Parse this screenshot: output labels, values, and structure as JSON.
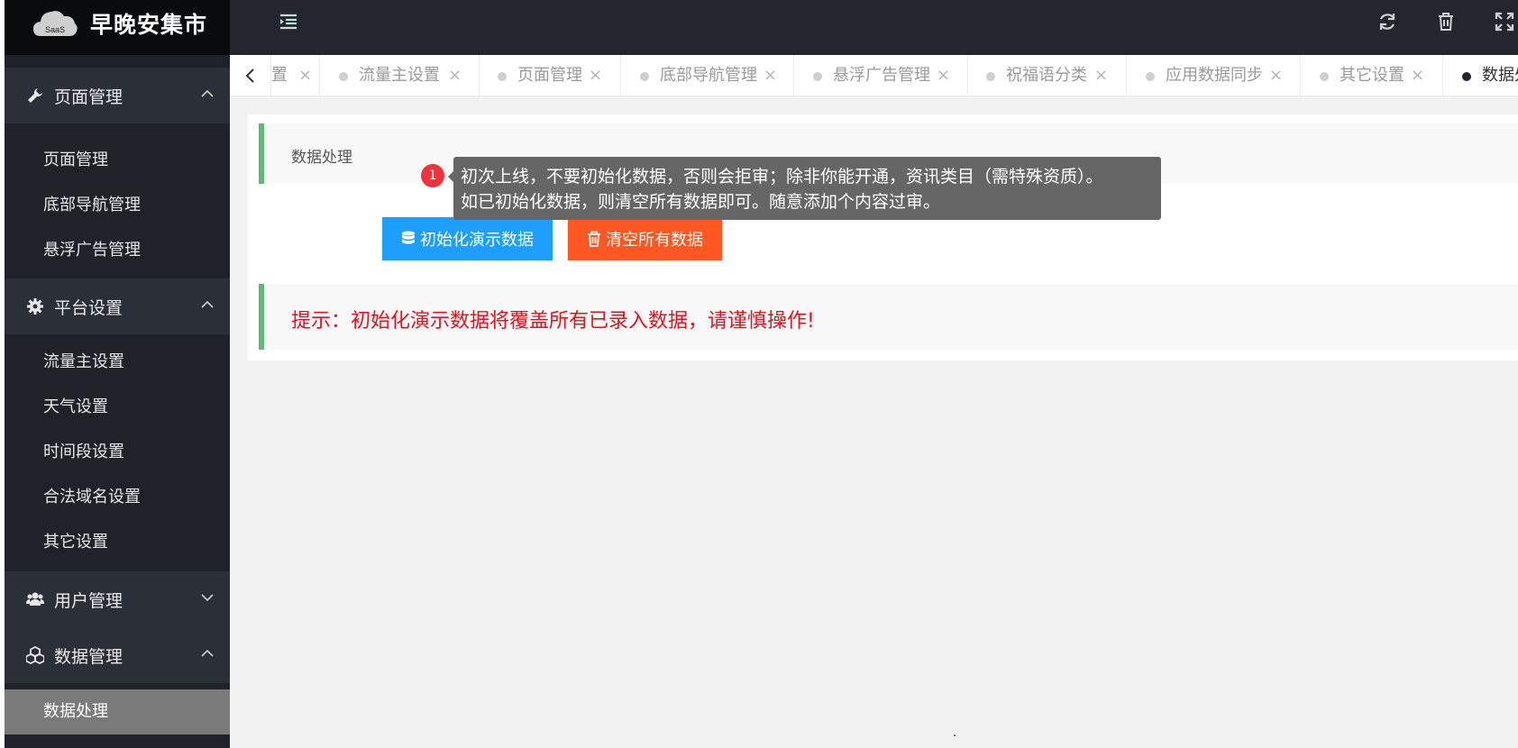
{
  "app": {
    "title": "早晚安集市",
    "logo_badge": "SaaS"
  },
  "colors": {
    "sidebar_bg": "#1f2229",
    "topbar_bg": "#23262e",
    "accent_green": "#5fb878",
    "primary_blue": "#1e9fff",
    "danger_orange": "#ff5722",
    "warning_red": "#e8101d"
  },
  "topbar": {
    "menu_toggle_icon": "indent-icon",
    "right_icons": [
      "refresh-icon",
      "trash-icon",
      "fullscreen-icon"
    ]
  },
  "sidebar": {
    "groups": [
      {
        "label": "页面管理",
        "icon": "wrench-icon",
        "expanded": true,
        "items": [
          "页面管理",
          "底部导航管理",
          "悬浮广告管理"
        ]
      },
      {
        "label": "平台设置",
        "icon": "gear-icon",
        "expanded": true,
        "items": [
          "流量主设置",
          "天气设置",
          "时间段设置",
          "合法域名设置",
          "其它设置"
        ]
      },
      {
        "label": "用户管理",
        "icon": "users-icon",
        "expanded": false,
        "items": []
      },
      {
        "label": "数据管理",
        "icon": "cubes-icon",
        "expanded": true,
        "items": [
          "数据处理"
        ]
      }
    ],
    "active_item": "数据处理"
  },
  "tabs": {
    "items": [
      "置",
      "流量主设置",
      "页面管理",
      "底部导航管理",
      "悬浮广告管理",
      "祝福语分类",
      "应用数据同步",
      "其它设置",
      "数据处理"
    ],
    "active": "数据处理",
    "close_glyph": "×"
  },
  "content": {
    "title": "数据处理",
    "init_button": "初始化演示数据",
    "clear_button": "清空所有数据",
    "tip": "提示：初始化演示数据将覆盖所有已录入数据，请谨慎操作!"
  },
  "tooltip": {
    "badge": "1",
    "line1": "初次上线，不要初始化数据，否则会拒审；除非你能开通，资讯类目（需特殊资质）。",
    "line2": "如已初始化数据，则清空所有数据即可。随意添加个内容过审。"
  }
}
